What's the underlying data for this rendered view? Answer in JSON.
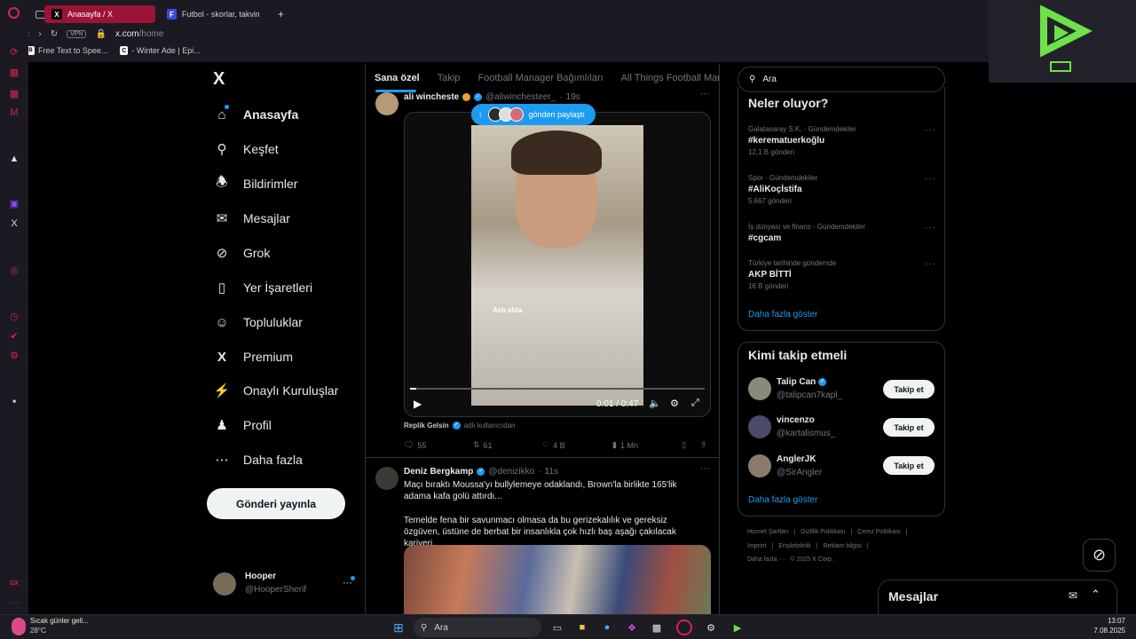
{
  "browser": {
    "tabs": [
      {
        "label": "Anasayfa / X",
        "active": true
      },
      {
        "label": "Futbol - skorlar, takvim & ",
        "active": false
      }
    ],
    "new_tab": "+",
    "address": "x.com/home",
    "address_host": "x.com",
    "address_path": "/home",
    "vpn_label": "VPN",
    "bookmarks": [
      "Free Text to Spee...",
      "- Winter Ade | Epi..."
    ]
  },
  "nav": {
    "logo": "X",
    "items": [
      {
        "label": "Anasayfa",
        "icon": "home-icon"
      },
      {
        "label": "Keşfet",
        "icon": "search-icon"
      },
      {
        "label": "Bildirimler",
        "icon": "bell-icon"
      },
      {
        "label": "Mesajlar",
        "icon": "mail-icon"
      },
      {
        "label": "Grok",
        "icon": "grok-icon"
      },
      {
        "label": "Yer İşaretleri",
        "icon": "bookmark-icon"
      },
      {
        "label": "Topluluklar",
        "icon": "communities-icon"
      },
      {
        "label": "Premium",
        "icon": "x-premium-icon"
      },
      {
        "label": "Onaylı Kuruluşlar",
        "icon": "lightning-icon"
      },
      {
        "label": "Profil",
        "icon": "person-icon"
      },
      {
        "label": "Daha fazla",
        "icon": "more-circle-icon"
      }
    ],
    "post_button": "Gönderi yayınla",
    "account": {
      "name": "Hooper",
      "handle": "@HooperSherif",
      "more": "···"
    }
  },
  "feed": {
    "tabs": [
      "Sana özel",
      "Takip",
      "Football Manager Bağımlıları",
      "All Things Football Manag"
    ],
    "post1": {
      "author": "ali wincheste",
      "handle": "@aliwinchesteer_",
      "time": "19s",
      "more": "···",
      "shared_pill": "gönderi paylaştı",
      "subtitle": "Aslı abla.",
      "video_time": "0:01 / 0:47",
      "video_progress": 0.02,
      "reply_source": "Replik Gelsin",
      "reply_source_suffix": "adlı kullanıcıdan",
      "stats": {
        "replies": "55",
        "reposts": "61",
        "likes": "4 B",
        "views": "1 Mn"
      }
    },
    "post2": {
      "author": "Deniz Bergkamp",
      "handle": "@denizikko",
      "time": "11s",
      "more": "···",
      "text1": "Maçı bıraktı Moussa'yı bullylemeye odaklandı, Brown'la birlikte 165'lik adama kafa golü attırdı...",
      "text2": "Temelde fena bir savunmacı olmasa da bu gerizekalılık ve gereksiz özgüven, üstüne de berbat bir insanlıkla çok hızlı baş aşağı çakılacak kariyeri."
    }
  },
  "right": {
    "search_placeholder": "Ara",
    "trends_title": "Neler oluyor?",
    "trends": [
      {
        "meta": "Galatasaray S.K. · Gündemdekiler",
        "name": "#kerematuerkoğlu",
        "count": "12,1 B gönderi"
      },
      {
        "meta": "Spor · Gündemdekiler",
        "name": "#AliKoçİstifa",
        "count": "5.667 gönderi"
      },
      {
        "meta": "İş dünyası ve finans · Gündemdekiler",
        "name": "#cgcam",
        "count": ""
      },
      {
        "meta": "Türkiye tarihinde gündemde",
        "name": "AKP BİTTİ",
        "count": "16 B gönderi"
      }
    ],
    "trends_more": "Daha fazla göster",
    "follow_title": "Kimi takip etmeli",
    "follow": [
      {
        "name": "Talip Can",
        "handle": "@talipcan7kapl_",
        "verified": true,
        "button": "Takip et"
      },
      {
        "name": "vincenzo",
        "handle": "@kartalismus_",
        "verified": false,
        "button": "Takip et"
      },
      {
        "name": "AnglerJK",
        "handle": "@SirAngler",
        "verified": false,
        "button": "Takip et"
      }
    ],
    "follow_more": "Daha fazla göster",
    "footer_row1": [
      "Hizmet Şartları",
      "Gizlilik Politikası",
      "Çerez Politikası"
    ],
    "footer_row2": [
      "Imprint",
      "Erişilebilirlik",
      "Reklam bilgisi"
    ],
    "footer_row3": [
      "Daha fazla ···",
      "© 2025 X Corp."
    ]
  },
  "messages_dock": {
    "title": "Mesajlar"
  },
  "taskbar": {
    "weather_title": "Sıcak günler geli...",
    "weather_temp": "28°C",
    "search": "Ara",
    "time": "13:07",
    "date": "7.08.2025"
  },
  "colors": {
    "accent": "#1d9bf0",
    "opera_red": "#d4244f",
    "active_tab": "#9b1335"
  }
}
